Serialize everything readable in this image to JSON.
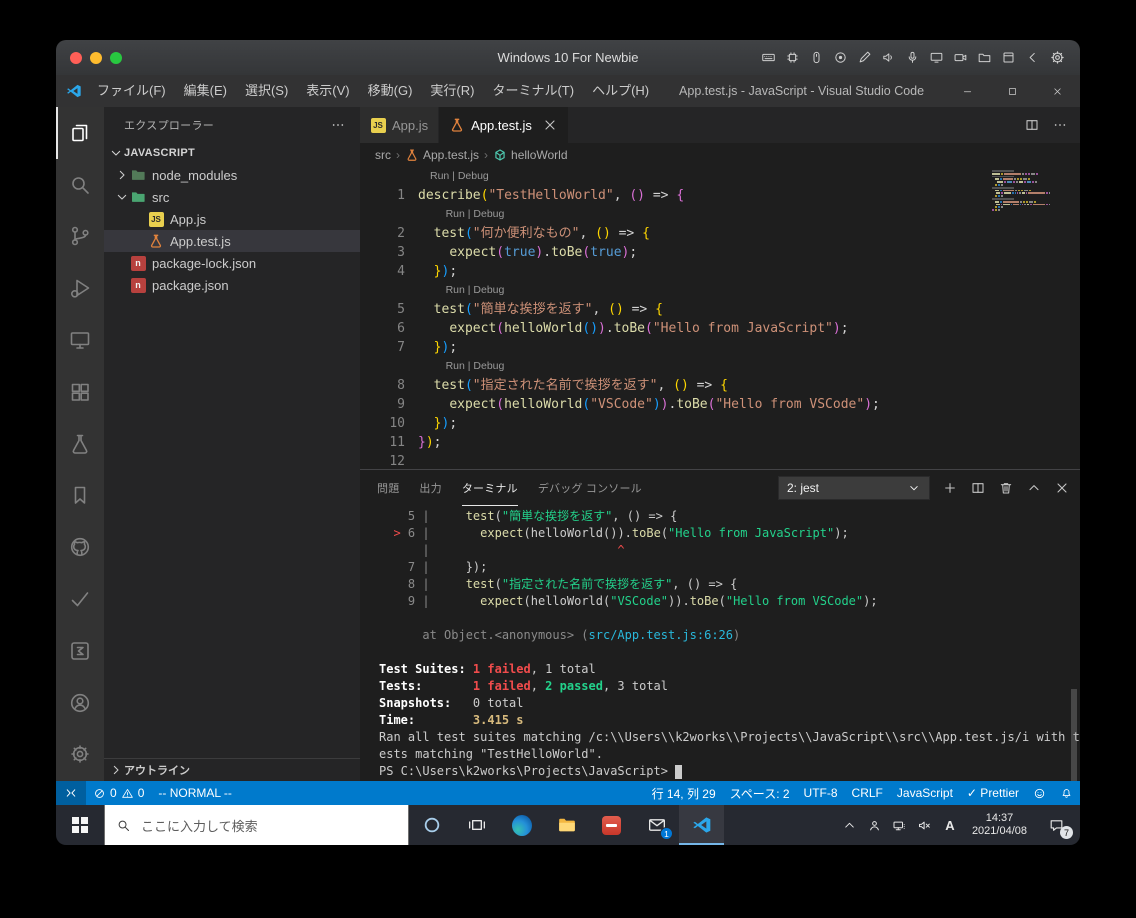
{
  "colors": {
    "statusbar_blue": "#007acc",
    "editor_bg": "#1e1e1e",
    "sidebar_bg": "#252526",
    "activitybar_bg": "#333333",
    "error_red": "#f14c4c",
    "pass_green": "#23d18b",
    "string_orange": "#ce9178",
    "function_yellow": "#dcdcaa"
  },
  "host": {
    "title": "Windows 10 For Newbie",
    "toolbar_icons": [
      "keyboard-icon",
      "processor-icon",
      "mouse-icon",
      "record-icon",
      "pen-icon",
      "speaker-icon",
      "microphone-icon",
      "display-icon",
      "camera-icon",
      "shared-folder-icon",
      "screenshot-icon",
      "back-icon",
      "gear-icon"
    ]
  },
  "vscode": {
    "title": "App.test.js - JavaScript - Visual Studio Code",
    "menus": [
      "ファイル(F)",
      "編集(E)",
      "選択(S)",
      "表示(V)",
      "移動(G)",
      "実行(R)",
      "ターミナル(T)",
      "ヘルプ(H)"
    ],
    "activity_bar": [
      {
        "icon": "explorer-icon",
        "name": "activity-explorer",
        "active": true
      },
      {
        "icon": "search-icon",
        "name": "activity-search"
      },
      {
        "icon": "source-control-icon",
        "name": "activity-source-control"
      },
      {
        "icon": "run-debug-icon",
        "name": "activity-run-debug"
      },
      {
        "icon": "remote-targets-icon",
        "name": "activity-remote-explorer"
      },
      {
        "icon": "extensions-icon",
        "name": "activity-extensions"
      },
      {
        "icon": "flask-icon",
        "name": "activity-test-explorer"
      },
      {
        "icon": "bookmark-icon",
        "name": "activity-bookmarks"
      },
      {
        "icon": "github-icon",
        "name": "activity-github"
      },
      {
        "icon": "check-icon",
        "name": "activity-todo"
      },
      {
        "icon": "sigma-icon",
        "name": "activity-output"
      },
      {
        "icon": "account-icon",
        "name": "activity-account"
      },
      {
        "icon": "gear-icon",
        "name": "activity-settings"
      }
    ],
    "explorer": {
      "title": "エクスプローラー",
      "section": "JAVASCRIPT",
      "outline": "アウトライン",
      "items": [
        {
          "label": "node_modules",
          "icon": "folder-node-icon",
          "chevron": "collapsed",
          "indent": 0
        },
        {
          "label": "src",
          "icon": "folder-src-icon",
          "chevron": "expanded",
          "indent": 0
        },
        {
          "label": "App.js",
          "icon": "js-badge-icon",
          "indent": 1
        },
        {
          "label": "App.test.js",
          "icon": "flask-file-icon",
          "indent": 1,
          "selected": true
        },
        {
          "label": "package-lock.json",
          "icon": "npm-icon",
          "indent": 0
        },
        {
          "label": "package.json",
          "icon": "npm-icon",
          "indent": 0
        }
      ]
    },
    "editor": {
      "tabs": [
        {
          "label": "App.js",
          "icon": "js-badge-icon",
          "active": false
        },
        {
          "label": "App.test.js",
          "icon": "flask-file-icon",
          "active": true,
          "closable": true
        }
      ],
      "breadcrumb_separator": "›",
      "breadcrumbs": [
        {
          "label": "src"
        },
        {
          "label": "App.test.js",
          "icon": "flask-file-icon"
        },
        {
          "label": "helloWorld",
          "icon": "symbol-icon"
        }
      ],
      "codelens_label": "Run | Debug",
      "lines": [
        {
          "lens": true,
          "indent": 0
        },
        {
          "num": "1",
          "tokens": [
            [
              "describe",
              "fn"
            ],
            [
              "(",
              "d1"
            ],
            [
              "\"TestHelloWorld\"",
              "str"
            ],
            [
              ", ",
              "p"
            ],
            [
              "(",
              "d2"
            ],
            [
              ")",
              "d2"
            ],
            [
              " => ",
              "p"
            ],
            [
              "{",
              "d2"
            ]
          ]
        },
        {
          "lens": true,
          "indent": 2
        },
        {
          "num": "2",
          "tokens": [
            [
              "  ",
              "p"
            ],
            [
              "test",
              "fn"
            ],
            [
              "(",
              "d3"
            ],
            [
              "\"何か便利なもの\"",
              "str"
            ],
            [
              ", ",
              "p"
            ],
            [
              "(",
              "d1"
            ],
            [
              ")",
              "d1"
            ],
            [
              " => ",
              "p"
            ],
            [
              "{",
              "d1"
            ]
          ]
        },
        {
          "num": "3",
          "tokens": [
            [
              "    ",
              "p"
            ],
            [
              "expect",
              "fn"
            ],
            [
              "(",
              "d2"
            ],
            [
              "true",
              "kw"
            ],
            [
              ")",
              "d2"
            ],
            [
              ".",
              "p"
            ],
            [
              "toBe",
              "fn"
            ],
            [
              "(",
              "d2"
            ],
            [
              "true",
              "kw"
            ],
            [
              ")",
              "d2"
            ],
            [
              ";",
              "p"
            ]
          ]
        },
        {
          "num": "4",
          "tokens": [
            [
              "  ",
              "p"
            ],
            [
              "}",
              "d1"
            ],
            [
              ")",
              "d3"
            ],
            [
              ";",
              "p"
            ]
          ]
        },
        {
          "lens": true,
          "indent": 2
        },
        {
          "num": "5",
          "tokens": [
            [
              "  ",
              "p"
            ],
            [
              "test",
              "fn"
            ],
            [
              "(",
              "d3"
            ],
            [
              "\"簡単な挨拶を返す\"",
              "str"
            ],
            [
              ", ",
              "p"
            ],
            [
              "(",
              "d1"
            ],
            [
              ")",
              "d1"
            ],
            [
              " => ",
              "p"
            ],
            [
              "{",
              "d1"
            ]
          ]
        },
        {
          "num": "6",
          "tokens": [
            [
              "    ",
              "p"
            ],
            [
              "expect",
              "fn"
            ],
            [
              "(",
              "d2"
            ],
            [
              "helloWorld",
              "fn"
            ],
            [
              "(",
              "d3"
            ],
            [
              ")",
              "d3"
            ],
            [
              ")",
              "d2"
            ],
            [
              ".",
              "p"
            ],
            [
              "toBe",
              "fn"
            ],
            [
              "(",
              "d2"
            ],
            [
              "\"Hello from JavaScript\"",
              "str"
            ],
            [
              ")",
              "d2"
            ],
            [
              ";",
              "p"
            ]
          ]
        },
        {
          "num": "7",
          "tokens": [
            [
              "  ",
              "p"
            ],
            [
              "}",
              "d1"
            ],
            [
              ")",
              "d3"
            ],
            [
              ";",
              "p"
            ]
          ]
        },
        {
          "lens": true,
          "indent": 2
        },
        {
          "num": "8",
          "tokens": [
            [
              "  ",
              "p"
            ],
            [
              "test",
              "fn"
            ],
            [
              "(",
              "d3"
            ],
            [
              "\"指定された名前で挨拶を返す\"",
              "str"
            ],
            [
              ", ",
              "p"
            ],
            [
              "(",
              "d1"
            ],
            [
              ")",
              "d1"
            ],
            [
              " => ",
              "p"
            ],
            [
              "{",
              "d1"
            ]
          ]
        },
        {
          "num": "9",
          "tokens": [
            [
              "    ",
              "p"
            ],
            [
              "expect",
              "fn"
            ],
            [
              "(",
              "d2"
            ],
            [
              "helloWorld",
              "fn"
            ],
            [
              "(",
              "d3"
            ],
            [
              "\"VSCode\"",
              "str"
            ],
            [
              ")",
              "d3"
            ],
            [
              ")",
              "d2"
            ],
            [
              ".",
              "p"
            ],
            [
              "toBe",
              "fn"
            ],
            [
              "(",
              "d2"
            ],
            [
              "\"Hello from VSCode\"",
              "str"
            ],
            [
              ")",
              "d2"
            ],
            [
              ";",
              "p"
            ]
          ]
        },
        {
          "num": "10",
          "tokens": [
            [
              "  ",
              "p"
            ],
            [
              "}",
              "d1"
            ],
            [
              ")",
              "d3"
            ],
            [
              ";",
              "p"
            ]
          ]
        },
        {
          "num": "11",
          "tokens": [
            [
              "}",
              "d2"
            ],
            [
              ")",
              "d1"
            ],
            [
              ";",
              "p"
            ]
          ]
        },
        {
          "num": "12",
          "tokens": []
        }
      ]
    },
    "panel": {
      "tabs": [
        {
          "label": "問題"
        },
        {
          "label": "出力"
        },
        {
          "label": "ターミナル",
          "active": true
        },
        {
          "label": "デバッグ コンソール"
        }
      ],
      "shell_selector": "2: jest",
      "terminal": [
        [
          [
            "    5 | ",
            "g"
          ],
          [
            "    ",
            "w"
          ],
          [
            "test",
            "y"
          ],
          [
            "(",
            "w"
          ],
          [
            "\"簡単な挨拶を返す\"",
            "grn"
          ],
          [
            ", () => {",
            "w"
          ]
        ],
        [
          [
            "  ",
            "w"
          ],
          [
            ">",
            "r"
          ],
          [
            " 6 | ",
            "g"
          ],
          [
            "      ",
            "w"
          ],
          [
            "expect",
            "y"
          ],
          [
            "(helloWorld()).",
            "w"
          ],
          [
            "toBe",
            "y"
          ],
          [
            "(",
            "w"
          ],
          [
            "\"Hello from JavaScript\"",
            "grn"
          ],
          [
            ");",
            "w"
          ]
        ],
        [
          [
            "      | ",
            "g"
          ],
          [
            "                         ",
            "w"
          ],
          [
            "^",
            "r"
          ]
        ],
        [
          [
            "    7 | ",
            "g"
          ],
          [
            "    });",
            "w"
          ]
        ],
        [
          [
            "    8 | ",
            "g"
          ],
          [
            "    ",
            "w"
          ],
          [
            "test",
            "y"
          ],
          [
            "(",
            "w"
          ],
          [
            "\"指定された名前で挨拶を返す\"",
            "grn"
          ],
          [
            ", () => {",
            "w"
          ]
        ],
        [
          [
            "    9 | ",
            "g"
          ],
          [
            "      ",
            "w"
          ],
          [
            "expect",
            "y"
          ],
          [
            "(helloWorld(",
            "w"
          ],
          [
            "\"VSCode\"",
            "grn"
          ],
          [
            ")).",
            "w"
          ],
          [
            "toBe",
            "y"
          ],
          [
            "(",
            "w"
          ],
          [
            "\"Hello from VSCode\"",
            "grn"
          ],
          [
            ");",
            "w"
          ]
        ],
        [],
        [
          [
            "      at Object.<anonymous> (",
            "g"
          ],
          [
            "src/App.test.js:6:26",
            "cy"
          ],
          [
            ")",
            "g"
          ]
        ],
        [],
        [
          [
            "Test Suites: ",
            "bw"
          ],
          [
            "1 failed",
            "rb"
          ],
          [
            ", 1 total",
            "w"
          ]
        ],
        [
          [
            "Tests:       ",
            "bw"
          ],
          [
            "1 failed",
            "rb"
          ],
          [
            ", ",
            "w"
          ],
          [
            "2 passed",
            "gb"
          ],
          [
            ", 3 total",
            "w"
          ]
        ],
        [
          [
            "Snapshots:   ",
            "bw"
          ],
          [
            "0 total",
            "w"
          ]
        ],
        [
          [
            "Time:        ",
            "bw"
          ],
          [
            "3.415 s",
            "yb"
          ]
        ],
        [
          [
            "Ran all test suites matching /c:\\\\Users\\\\k2works\\\\Projects\\\\JavaScript\\\\src\\\\App.test.js/i with t",
            "w"
          ]
        ],
        [
          [
            "ests matching \"TestHelloWorld\".",
            "w"
          ]
        ],
        [
          [
            "PS C:\\Users\\k2works\\Projects\\JavaScript> ",
            "w"
          ],
          [
            "",
            "cursor"
          ]
        ]
      ]
    },
    "status_bar": {
      "errors": "0",
      "warnings": "0",
      "mode": "-- NORMAL --",
      "line_col": "行 14, 列 29",
      "indentation": "スペース: 2",
      "encoding": "UTF-8",
      "eol": "CRLF",
      "language": "JavaScript",
      "formatter": "✓ Prettier"
    }
  },
  "taskbar": {
    "search_placeholder": "ここに入力して検索",
    "buttons": [
      {
        "icon": "cortana-icon",
        "name": "cortana-button"
      },
      {
        "icon": "task-view-icon",
        "name": "task-view-button"
      },
      {
        "icon": "edge-icon",
        "name": "edge-button"
      },
      {
        "icon": "folder-icon",
        "name": "file-explorer-button"
      },
      {
        "icon": "red-app-icon",
        "name": "pinned-app-button"
      },
      {
        "icon": "mail-icon",
        "name": "mail-button",
        "badge": "1"
      },
      {
        "icon": "vscode-icon",
        "name": "vscode-button",
        "active": true
      }
    ],
    "tray_icons": [
      {
        "icon": "chevron-up-icon",
        "name": "tray-expand-button"
      },
      {
        "icon": "person-icon",
        "name": "tray-people-icon"
      },
      {
        "icon": "network-icon",
        "name": "tray-network-icon"
      },
      {
        "icon": "volume-muted-icon",
        "name": "tray-volume-icon"
      }
    ],
    "ime_mode": "A",
    "time": "14:37",
    "date": "2021/04/08",
    "notification_badge": "7"
  }
}
